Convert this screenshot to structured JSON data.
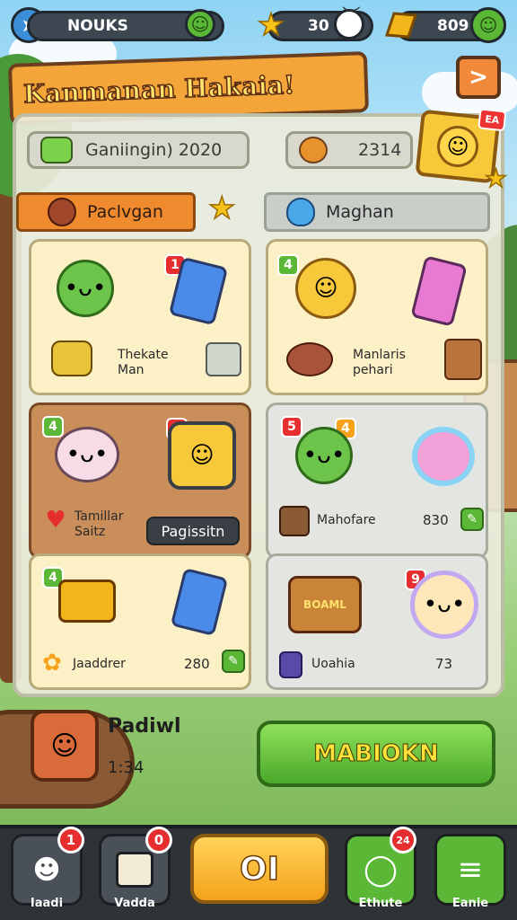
{
  "topbar": {
    "player_label": "NOUKS",
    "stars_value": "30",
    "coins_value": "809"
  },
  "banner": {
    "title": "Kanmanan Hakaia!"
  },
  "stats": {
    "left": "Ganiingin) 2020",
    "right": "2314"
  },
  "tabs": [
    {
      "label": "Paclvgan"
    },
    {
      "label": "Maghan"
    }
  ],
  "cards": [
    {
      "chip": "1",
      "text_1": "Thekate",
      "text_2": "Man"
    },
    {
      "chip": "4",
      "text_1": "Manlaris",
      "text_2": "pehari"
    },
    {
      "chip": "4",
      "chip_2": "0",
      "text_1": "Tamillar",
      "text_2": "Saitz",
      "button": "Pagissitn"
    },
    {
      "chip": "5",
      "chip_2": "4",
      "text_1": "Mahofare",
      "value": "830"
    },
    {
      "chip": "4",
      "text_1": "Jaaddrer",
      "value": "280"
    },
    {
      "chip": "9",
      "art_label": "BOAML",
      "text_1": "Uoahia",
      "value": "73"
    }
  ],
  "player": {
    "name": "Padiwl",
    "time": "1:34"
  },
  "action_button": "MABIOKN",
  "nav": {
    "left_1": {
      "label": "Iaadi",
      "badge": "1"
    },
    "left_2": {
      "label": "Vadda",
      "badge": "0"
    },
    "center": "OI",
    "right_1": {
      "label": "Ethute",
      "badge": "24"
    },
    "right_2": {
      "label": "Eanie"
    }
  },
  "colors": {
    "accent": "#f08a2e",
    "green": "#5ab836",
    "banner": "#f4a53a"
  }
}
